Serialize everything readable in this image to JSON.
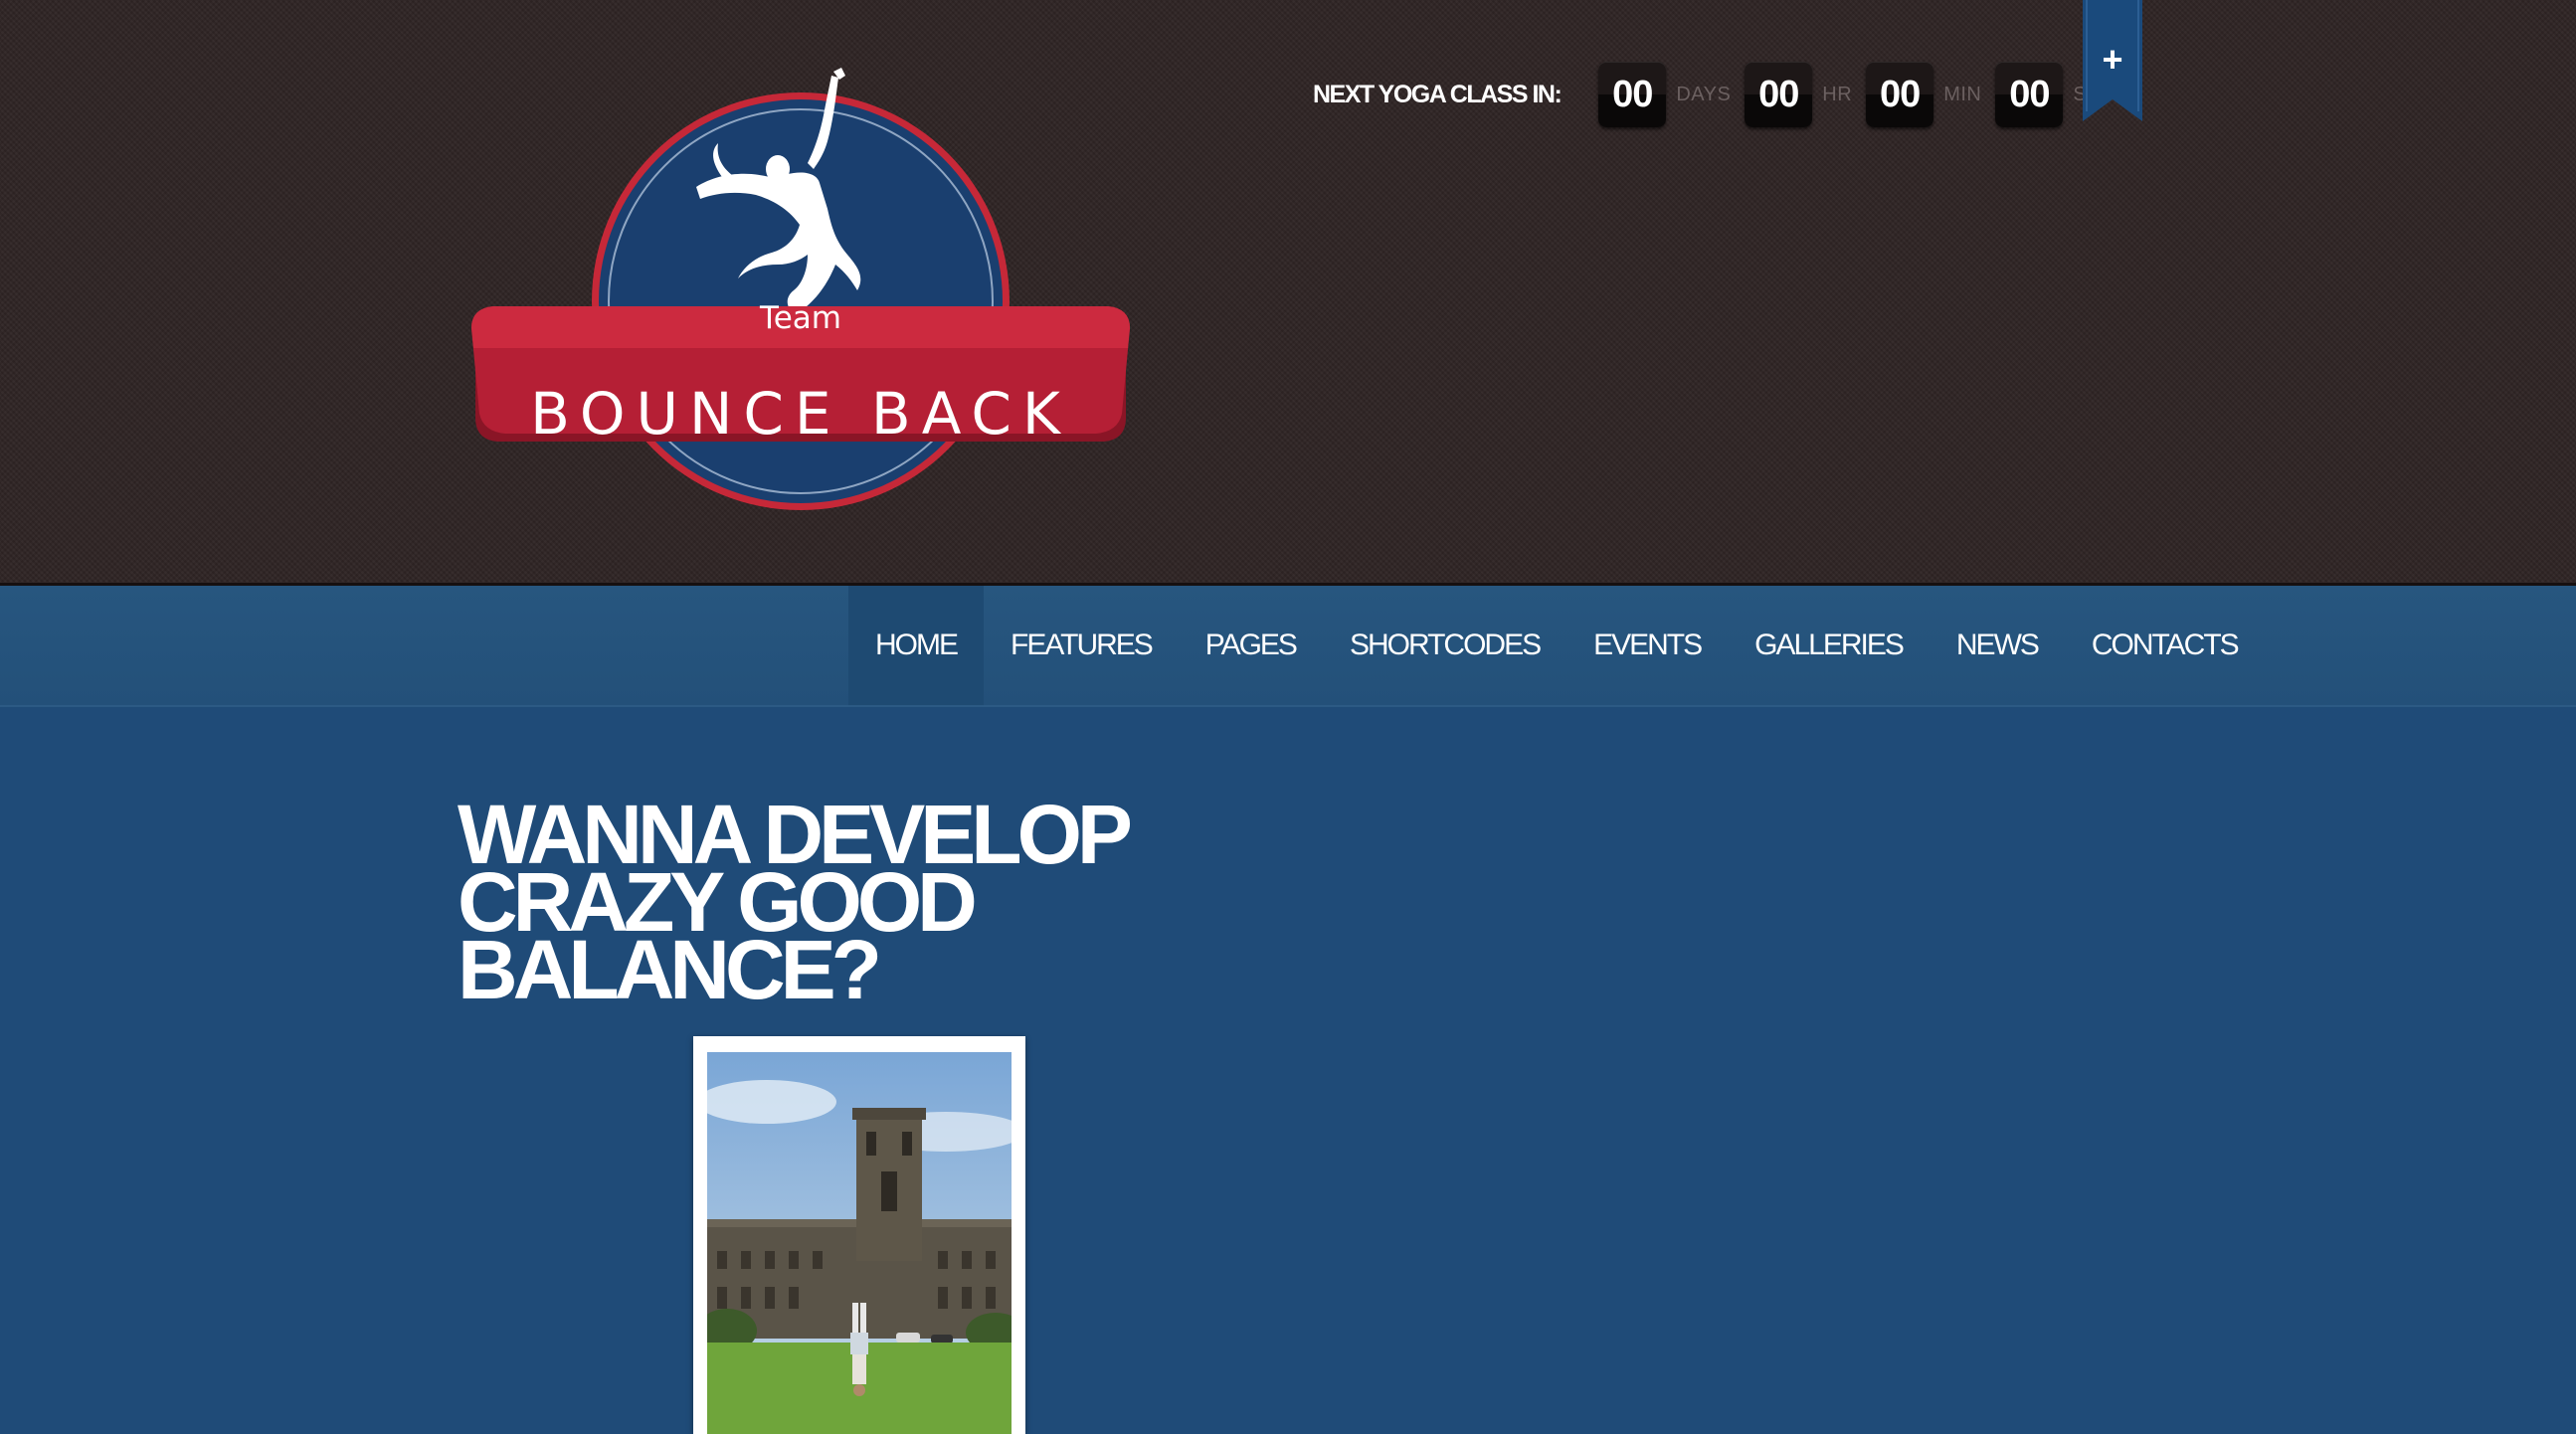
{
  "logo": {
    "small_text": "Team",
    "main_text": "BOUNCE BACK",
    "colors": {
      "circle": "#1a3f6f",
      "banner": "#b51f35",
      "outline": "#c62838"
    }
  },
  "countdown": {
    "label": "NEXT YOGA CLASS IN:",
    "days": "00",
    "days_unit": "DAYS",
    "hours": "00",
    "hours_unit": "HR",
    "minutes": "00",
    "minutes_unit": "MIN",
    "seconds": "00",
    "seconds_unit": "S"
  },
  "ribbon": {
    "icon": "plus-icon",
    "label": "+"
  },
  "nav": {
    "items": [
      "HOME",
      "FEATURES",
      "PAGES",
      "SHORTCODES",
      "EVENTS",
      "GALLERIES",
      "NEWS",
      "CONTACTS"
    ],
    "active": "HOME"
  },
  "hero": {
    "line1": "WANNA DEVELOP",
    "line2": "CRAZY GOOD",
    "line3": "BALANCE?"
  },
  "colors": {
    "header_bg": "#2e2424",
    "nav_bg": "#27567f",
    "content_bg": "#1f4b78",
    "accent_blue": "#1a4a7c"
  }
}
